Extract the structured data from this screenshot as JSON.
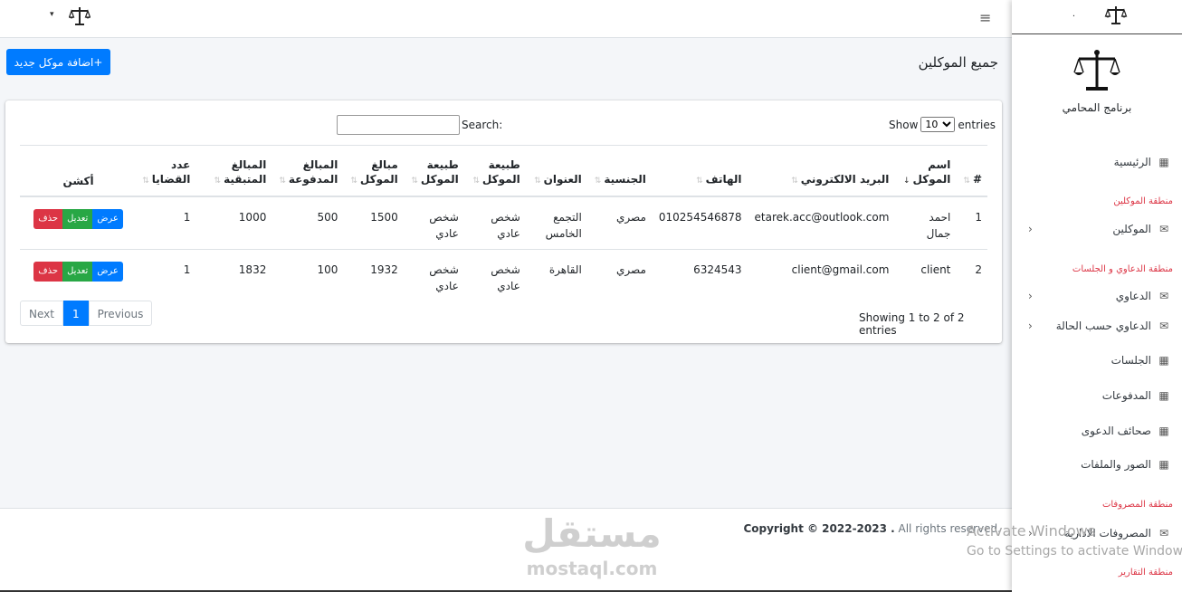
{
  "topbar": {
    "caret": "▾",
    "menu_icon": "≡"
  },
  "page": {
    "title": "جميع الموكلين",
    "add_button": "+اضافة موكل جديد"
  },
  "table_controls": {
    "show": "Show",
    "entries": "entries",
    "page_length": "10",
    "search_label": "Search:"
  },
  "table": {
    "headers": [
      {
        "label": "#",
        "sort": "⇅"
      },
      {
        "label": "اسم الموكل",
        "sort": "↓"
      },
      {
        "label": "البريد الالكتروني",
        "sort": "⇅"
      },
      {
        "label": "الهاتف",
        "sort": "⇅"
      },
      {
        "label": "الجنسية",
        "sort": "⇅"
      },
      {
        "label": "العنوان",
        "sort": "⇅"
      },
      {
        "label": "طبيعة الموكل",
        "sort": "⇅"
      },
      {
        "label": "طبيعة الموكل",
        "sort": "⇅"
      },
      {
        "label": "مبالغ الموكل",
        "sort": "⇅"
      },
      {
        "label": "المبالغ المدفوعة",
        "sort": "⇅"
      },
      {
        "label": "المبالغ المتبقية",
        "sort": "⇅"
      },
      {
        "label": "عدد القضايا",
        "sort": "⇅"
      },
      {
        "label": "أكشن",
        "sort": ""
      }
    ],
    "rows": [
      {
        "num": "1",
        "name": "احمد جمال",
        "email": "etarek.acc@outlook.com",
        "phone": "010254546878",
        "nationality": "مصري",
        "address": "التجمع الخامس",
        "nature1": "شخص عادي",
        "nature2": "شخص عادي",
        "amount": "1500",
        "paid": "500",
        "remaining": "1000",
        "cases": "1"
      },
      {
        "num": "2",
        "name": "client",
        "email": "client@gmail.com",
        "phone": "6324543",
        "nationality": "مصري",
        "address": "القاهرة",
        "nature1": "شخص عادي",
        "nature2": "شخص عادي",
        "amount": "1932",
        "paid": "100",
        "remaining": "1832",
        "cases": "1"
      }
    ],
    "actions": {
      "view": "عرض",
      "edit": "تعديل",
      "delete": "حذف"
    }
  },
  "pagination": {
    "info": "Showing 1 to 2 of 2 entries",
    "previous": "Previous",
    "current": "1",
    "next": "Next"
  },
  "footer": {
    "copyright": "Copyright © 2022-2023 .",
    "rights": " All rights reserved."
  },
  "watermark": {
    "arabic": "مستقل",
    "latin": "mostaql.com"
  },
  "sidebar": {
    "brand_dot": ".",
    "app_name": "برنامج المحامي",
    "items": {
      "home": "الرئيسية",
      "clients": "الموكلين",
      "cases": "الدعاوي",
      "cases_status": "الدعاوي حسب الحالة",
      "sessions": "الجلسات",
      "payments": "المدفوعات",
      "pleadings": "صحائف الدعوى",
      "files": "الصور والملفات",
      "admin_expenses": "المصروفات الادارية"
    },
    "headers": {
      "clients_zone": "منطقة الموكلين",
      "cases_zone": "منطقة الدعاوي و الجلسات",
      "expenses_zone": "منطقة المصروفات",
      "reports_zone": "منطقة التقارير"
    }
  },
  "os_overlay": {
    "title": "Activate Windows",
    "subtitle": "Go to Settings to activate Windows."
  },
  "colors": {
    "primary": "#007bff",
    "success": "#28a745",
    "danger": "#dc3545"
  }
}
